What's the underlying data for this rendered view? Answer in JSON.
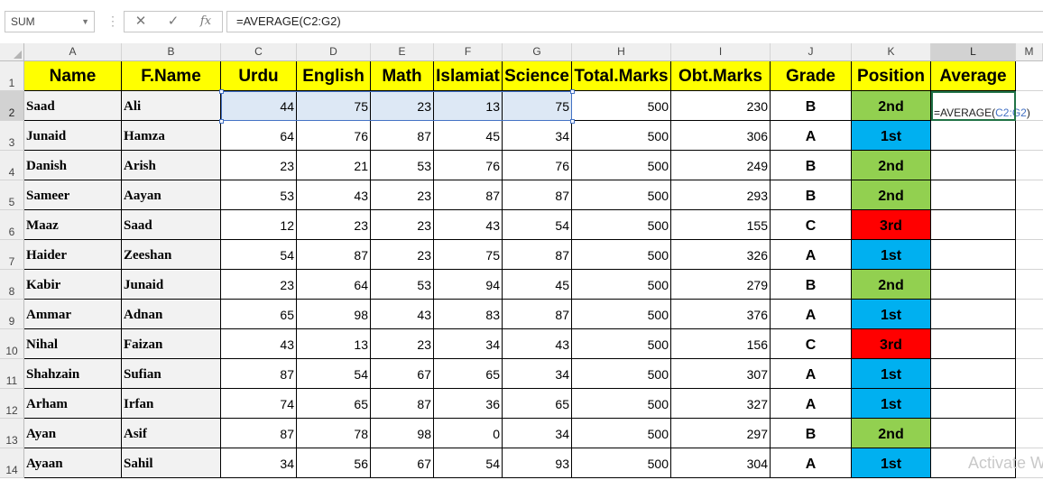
{
  "formula_bar": {
    "name_box": "SUM",
    "cancel_glyph": "✕",
    "enter_glyph": "✓",
    "fx_glyph": "fx",
    "formula": "=AVERAGE(C2:G2)"
  },
  "columns": [
    "A",
    "B",
    "C",
    "D",
    "E",
    "F",
    "G",
    "H",
    "I",
    "J",
    "K",
    "L",
    "M"
  ],
  "rows": [
    "1",
    "2",
    "3",
    "4",
    "5",
    "6",
    "7",
    "8",
    "9",
    "10",
    "11",
    "12",
    "13",
    "14"
  ],
  "headers": [
    "Name",
    "F.Name",
    "Urdu",
    "English",
    "Math",
    "Islamiat",
    "Science",
    "Total.Marks",
    "Obt.Marks",
    "Grade",
    "Position",
    "Average"
  ],
  "records": [
    {
      "name": "Saad",
      "fname": "Ali",
      "urdu": "44",
      "english": "75",
      "math": "23",
      "islamiat": "13",
      "science": "75",
      "total": "500",
      "obt": "230",
      "grade": "B",
      "position": "2nd"
    },
    {
      "name": "Junaid",
      "fname": "Hamza",
      "urdu": "64",
      "english": "76",
      "math": "87",
      "islamiat": "45",
      "science": "34",
      "total": "500",
      "obt": "306",
      "grade": "A",
      "position": "1st"
    },
    {
      "name": "Danish",
      "fname": "Arish",
      "urdu": "23",
      "english": "21",
      "math": "53",
      "islamiat": "76",
      "science": "76",
      "total": "500",
      "obt": "249",
      "grade": "B",
      "position": "2nd"
    },
    {
      "name": "Sameer",
      "fname": "Aayan",
      "urdu": "53",
      "english": "43",
      "math": "23",
      "islamiat": "87",
      "science": "87",
      "total": "500",
      "obt": "293",
      "grade": "B",
      "position": "2nd"
    },
    {
      "name": "Maaz",
      "fname": "Saad",
      "urdu": "12",
      "english": "23",
      "math": "23",
      "islamiat": "43",
      "science": "54",
      "total": "500",
      "obt": "155",
      "grade": "C",
      "position": "3rd"
    },
    {
      "name": "Haider",
      "fname": "Zeeshan",
      "urdu": "54",
      "english": "87",
      "math": "23",
      "islamiat": "75",
      "science": "87",
      "total": "500",
      "obt": "326",
      "grade": "A",
      "position": "1st"
    },
    {
      "name": "Kabir",
      "fname": "Junaid",
      "urdu": "23",
      "english": "64",
      "math": "53",
      "islamiat": "94",
      "science": "45",
      "total": "500",
      "obt": "279",
      "grade": "B",
      "position": "2nd"
    },
    {
      "name": "Ammar",
      "fname": "Adnan",
      "urdu": "65",
      "english": "98",
      "math": "43",
      "islamiat": "83",
      "science": "87",
      "total": "500",
      "obt": "376",
      "grade": "A",
      "position": "1st"
    },
    {
      "name": "Nihal",
      "fname": "Faizan",
      "urdu": "43",
      "english": "13",
      "math": "23",
      "islamiat": "34",
      "science": "43",
      "total": "500",
      "obt": "156",
      "grade": "C",
      "position": "3rd"
    },
    {
      "name": "Shahzain",
      "fname": "Sufian",
      "urdu": "87",
      "english": "54",
      "math": "67",
      "islamiat": "65",
      "science": "34",
      "total": "500",
      "obt": "307",
      "grade": "A",
      "position": "1st"
    },
    {
      "name": "Arham",
      "fname": "Irfan",
      "urdu": "74",
      "english": "65",
      "math": "87",
      "islamiat": "36",
      "science": "65",
      "total": "500",
      "obt": "327",
      "grade": "A",
      "position": "1st"
    },
    {
      "name": "Ayan",
      "fname": "Asif",
      "urdu": "87",
      "english": "78",
      "math": "98",
      "islamiat": "0",
      "science": "34",
      "total": "500",
      "obt": "297",
      "grade": "B",
      "position": "2nd"
    },
    {
      "name": "Ayaan",
      "fname": "Sahil",
      "urdu": "34",
      "english": "56",
      "math": "67",
      "islamiat": "54",
      "science": "93",
      "total": "500",
      "obt": "304",
      "grade": "A",
      "position": "1st"
    }
  ],
  "editing_cell": {
    "prefix": "=AVERAGE(",
    "ref": "C2:G2",
    "suffix": ")"
  },
  "position_colors": {
    "1st": "#00b0f0",
    "2nd": "#92d050",
    "3rd": "#ff0000"
  },
  "header_fill": "#ffff00",
  "watermark": "Activate W"
}
